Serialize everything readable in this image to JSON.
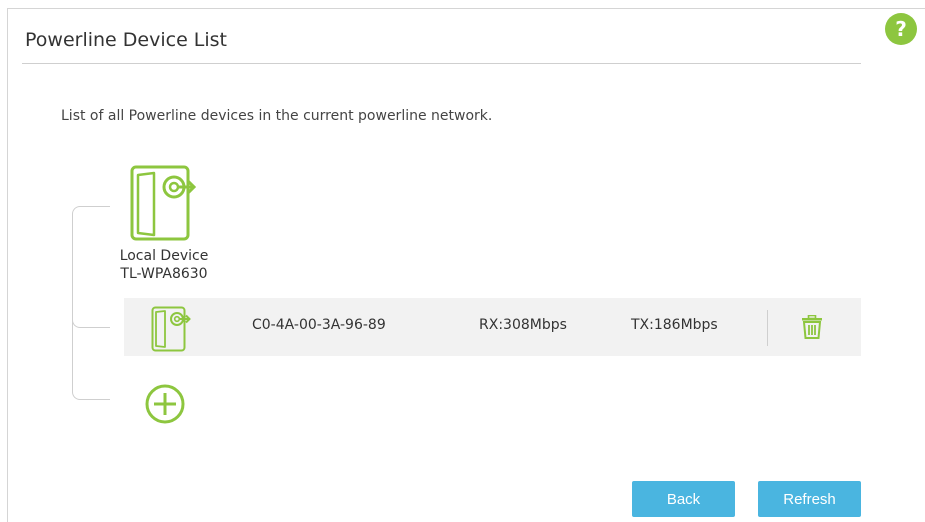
{
  "page": {
    "title": "Powerline Device List",
    "description": "List of all Powerline devices in the current powerline network.",
    "help_label": "?"
  },
  "local_device": {
    "name": "Local Device",
    "model": "TL-WPA8630",
    "icon": "powerline-adapter-icon"
  },
  "devices": [
    {
      "icon": "powerline-adapter-icon",
      "mac": "C0-4A-00-3A-96-89",
      "rx": "RX:308Mbps",
      "tx": "TX:186Mbps",
      "action_icon": "trash-icon"
    }
  ],
  "add_icon": "plus-circle-icon",
  "buttons": {
    "back": "Back",
    "refresh": "Refresh"
  },
  "colors": {
    "accent_green": "#8dc63f",
    "button_blue": "#4ab5e0",
    "row_bg": "#f2f2f2"
  }
}
